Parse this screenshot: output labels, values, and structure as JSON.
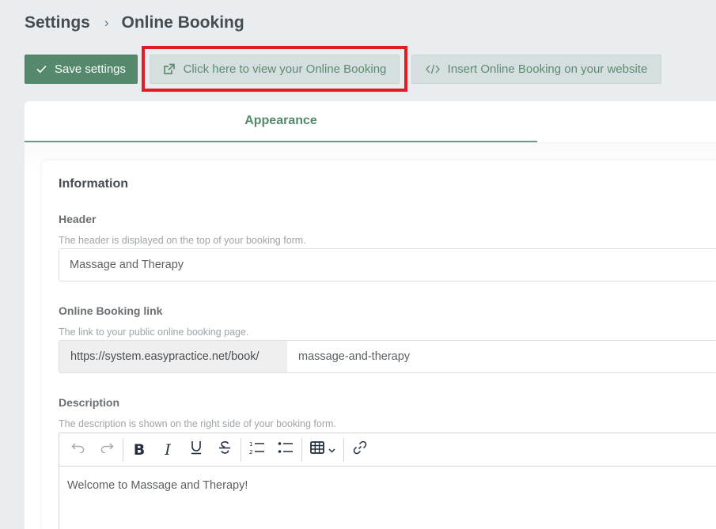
{
  "breadcrumb": {
    "parent": "Settings",
    "separator": "›",
    "current": "Online Booking"
  },
  "toolbar": {
    "save_label": "Save settings",
    "save_icon": "check-icon",
    "view_label": "Click here to view your Online Booking",
    "view_icon": "external-link-icon",
    "insert_label": "Insert Online Booking on your website",
    "insert_icon": "code-icon"
  },
  "tabs": [
    {
      "label": "Appearance",
      "active": true
    }
  ],
  "card": {
    "title": "Information",
    "header_field": {
      "label": "Header",
      "help": "The header is displayed on the top of your booking form.",
      "value": "Massage and Therapy"
    },
    "link_field": {
      "label": "Online Booking link",
      "help": "The link to your public online booking page.",
      "prefix": "https://system.easypractice.net/book/",
      "value": "massage-and-therapy"
    },
    "description_field": {
      "label": "Description",
      "help": "The description is shown on the right side of your booking form.",
      "toolbar": [
        "undo",
        "redo",
        "bold",
        "italic",
        "underline",
        "strikethrough",
        "numbered-list",
        "bulleted-list",
        "table",
        "link"
      ],
      "content": "Welcome to Massage and Therapy!"
    }
  },
  "colors": {
    "brand_green": "#54896c",
    "secondary_button_bg": "#d5dfdf",
    "highlight_red": "#e21b24",
    "page_bg": "#e9edf0"
  }
}
